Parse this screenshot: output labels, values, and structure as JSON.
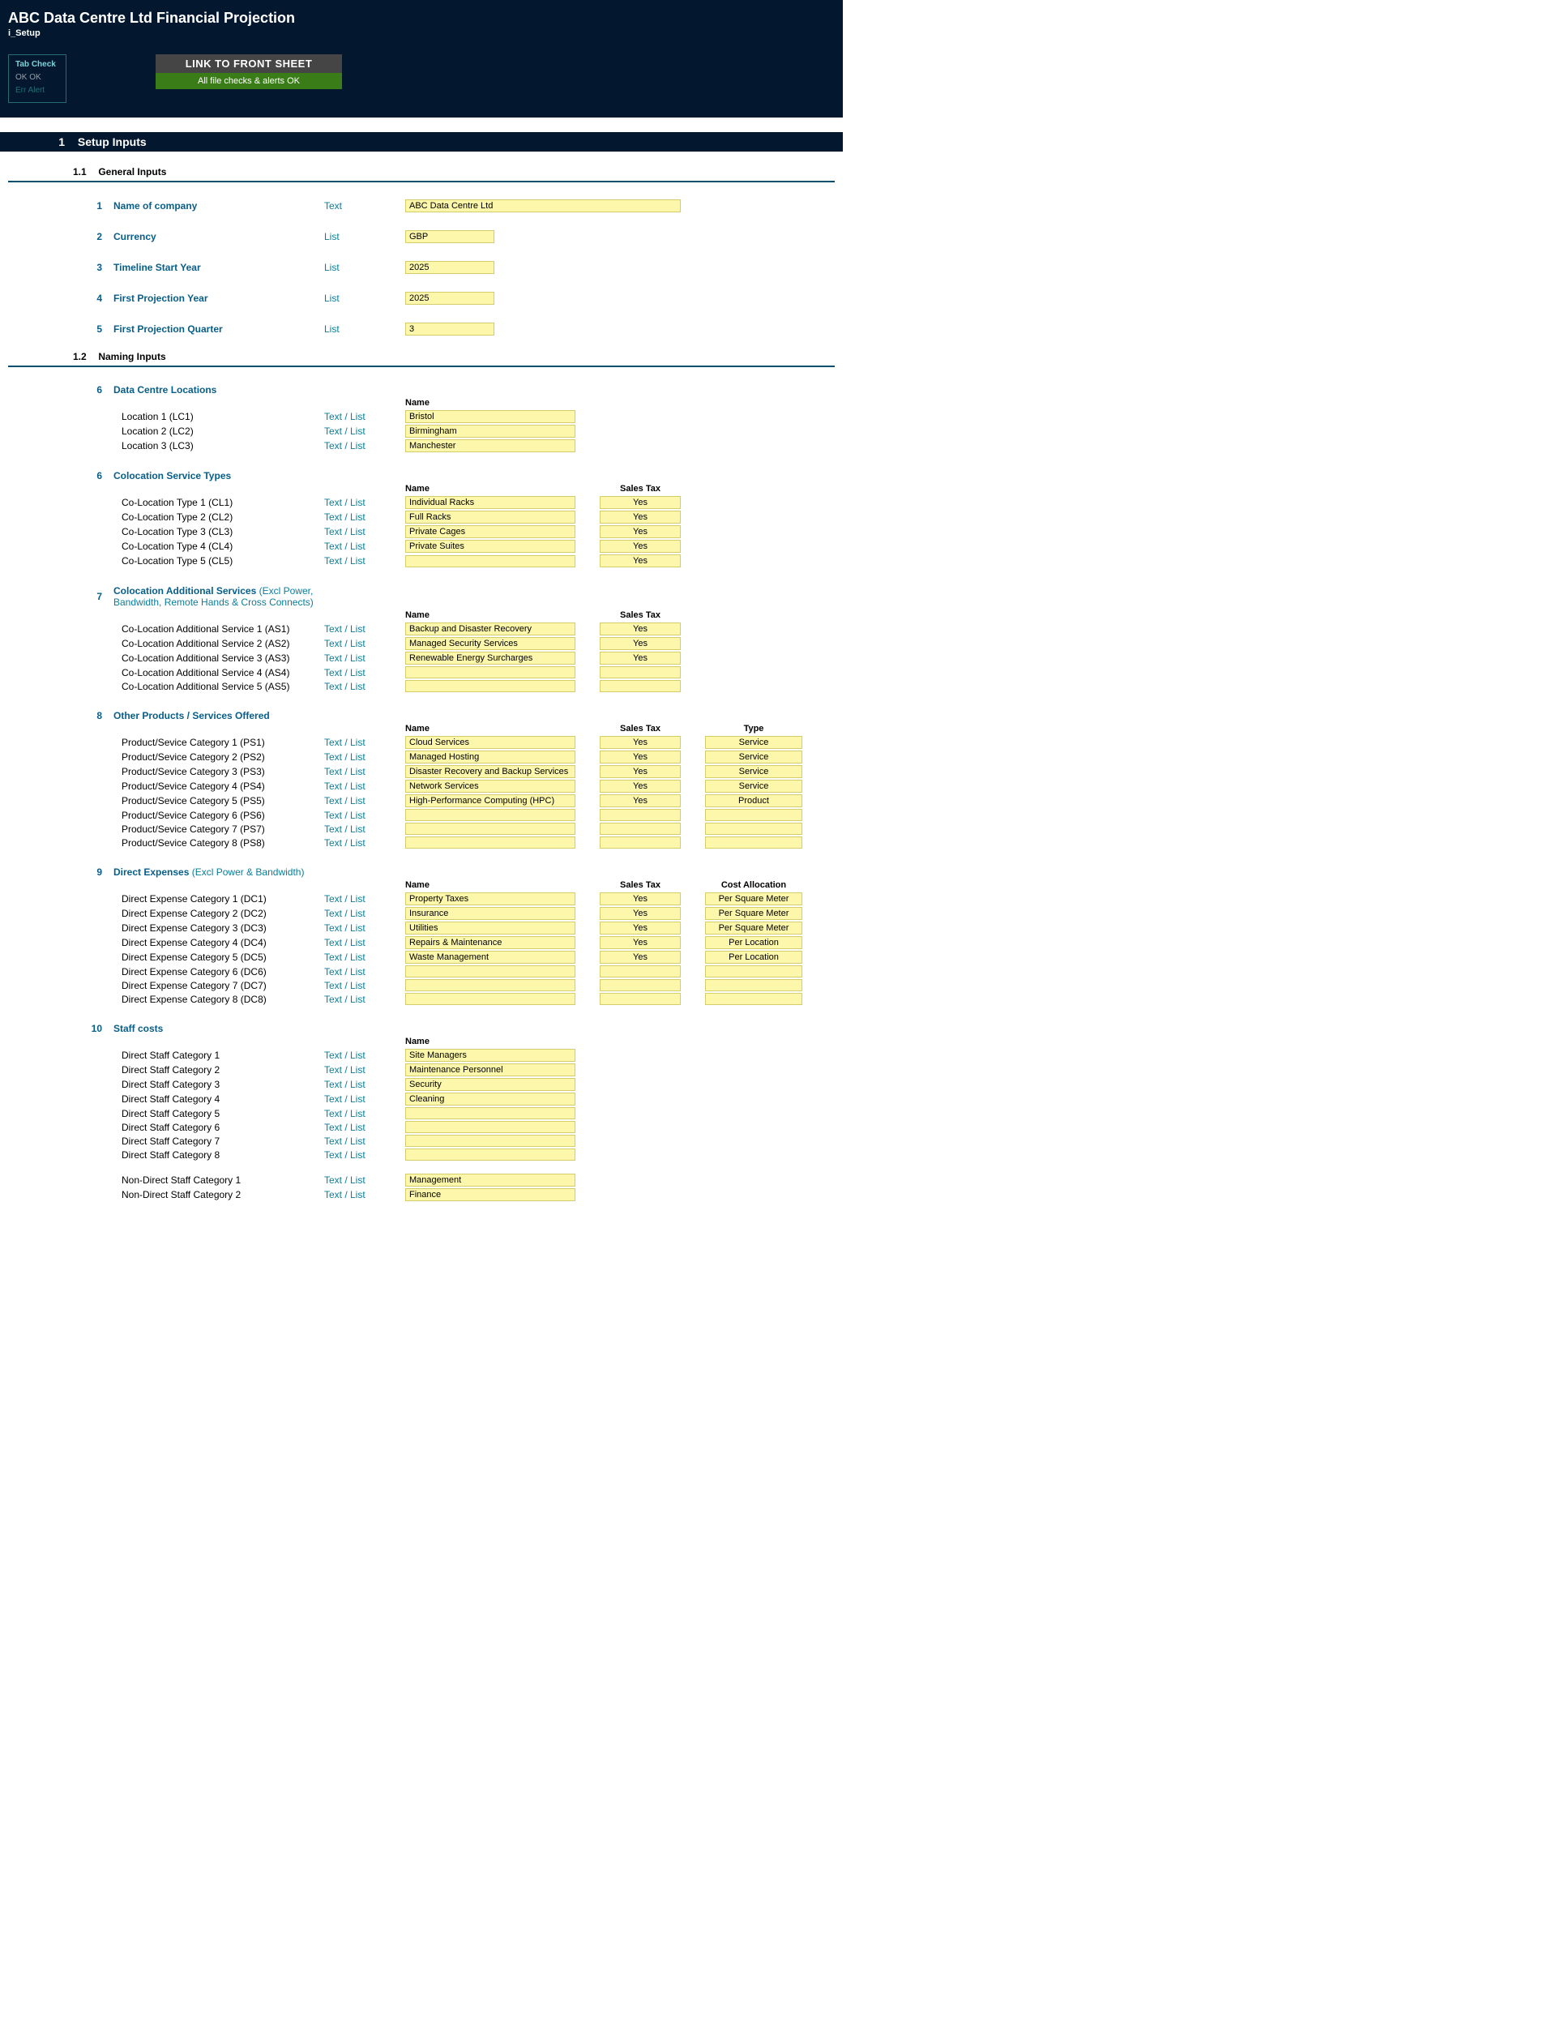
{
  "header": {
    "title": "ABC Data Centre Ltd Financial Projection",
    "subtitle": "i_Setup",
    "tabcheck": {
      "title": "Tab Check",
      "ok_row": "OK   OK",
      "err_row": "Err   Alert"
    },
    "linkbox": {
      "line1": "LINK TO FRONT SHEET",
      "line2": "All file checks & alerts OK"
    }
  },
  "section1": {
    "num": "1",
    "title": "Setup Inputs"
  },
  "sub11": {
    "num": "1.1",
    "title": "General Inputs"
  },
  "general": [
    {
      "idx": "1",
      "label": "Name of company",
      "type": "Text",
      "value": "ABC Data Centre Ltd",
      "wide": true
    },
    {
      "idx": "2",
      "label": "Currency",
      "type": "List",
      "value": "GBP",
      "short": true
    },
    {
      "idx": "3",
      "label": "Timeline Start Year",
      "type": "List",
      "value": "2025",
      "short": true
    },
    {
      "idx": "4",
      "label": "First Projection Year",
      "type": "List",
      "value": "2025",
      "short": true
    },
    {
      "idx": "5",
      "label": "First Projection Quarter",
      "type": "List",
      "value": "3",
      "short": true
    }
  ],
  "sub12": {
    "num": "1.2",
    "title": "Naming Inputs"
  },
  "locations": {
    "idx": "6",
    "title": "Data Centre Locations",
    "col1": "Name",
    "rows": [
      {
        "label": "Location 1 (LC1)",
        "type": "Text / List",
        "name": "Bristol"
      },
      {
        "label": "Location 2 (LC2)",
        "type": "Text / List",
        "name": "Birmingham"
      },
      {
        "label": "Location 3 (LC3)",
        "type": "Text / List",
        "name": "Manchester"
      }
    ]
  },
  "coloc": {
    "idx": "6",
    "title": "Colocation Service Types",
    "col1": "Name",
    "col2": "Sales Tax",
    "rows": [
      {
        "label": "Co-Location Type 1 (CL1)",
        "type": "Text / List",
        "name": "Individual Racks",
        "tax": "Yes"
      },
      {
        "label": "Co-Location Type 2 (CL2)",
        "type": "Text / List",
        "name": "Full Racks",
        "tax": "Yes"
      },
      {
        "label": "Co-Location Type 3 (CL3)",
        "type": "Text / List",
        "name": "Private Cages",
        "tax": "Yes"
      },
      {
        "label": "Co-Location Type 4 (CL4)",
        "type": "Text / List",
        "name": "Private Suites",
        "tax": "Yes"
      },
      {
        "label": "Co-Location Type 5 (CL5)",
        "type": "Text / List",
        "name": "",
        "tax": "Yes"
      }
    ]
  },
  "addsvc": {
    "idx": "7",
    "title": "Colocation Additional Services",
    "note": "(Excl Power, Bandwidth, Remote Hands & Cross Connects)",
    "col1": "Name",
    "col2": "Sales Tax",
    "rows": [
      {
        "label": "Co-Location Additional Service 1 (AS1)",
        "type": "Text / List",
        "name": "Backup and Disaster Recovery",
        "tax": "Yes"
      },
      {
        "label": "Co-Location Additional Service 2 (AS2)",
        "type": "Text / List",
        "name": "Managed Security Services",
        "tax": "Yes"
      },
      {
        "label": "Co-Location Additional Service 3 (AS3)",
        "type": "Text / List",
        "name": "Renewable Energy Surcharges",
        "tax": "Yes"
      },
      {
        "label": "Co-Location Additional Service 4 (AS4)",
        "type": "Text / List",
        "name": "",
        "tax": ""
      },
      {
        "label": "Co-Location Additional Service 5 (AS5)",
        "type": "Text / List",
        "name": "",
        "tax": ""
      }
    ]
  },
  "products": {
    "idx": "8",
    "title": "Other Products / Services Offered",
    "col1": "Name",
    "col2": "Sales Tax",
    "col3": "Type",
    "rows": [
      {
        "label": "Product/Sevice Category 1 (PS1)",
        "type": "Text / List",
        "name": "Cloud Services",
        "tax": "Yes",
        "ptype": "Service"
      },
      {
        "label": "Product/Sevice Category 2 (PS2)",
        "type": "Text / List",
        "name": "Managed Hosting",
        "tax": "Yes",
        "ptype": "Service"
      },
      {
        "label": "Product/Sevice Category 3 (PS3)",
        "type": "Text / List",
        "name": "Disaster Recovery and Backup Services",
        "tax": "Yes",
        "ptype": "Service"
      },
      {
        "label": "Product/Sevice Category 4 (PS4)",
        "type": "Text / List",
        "name": "Network Services",
        "tax": "Yes",
        "ptype": "Service"
      },
      {
        "label": "Product/Sevice Category 5 (PS5)",
        "type": "Text / List",
        "name": "High-Performance Computing (HPC)",
        "tax": "Yes",
        "ptype": "Product"
      },
      {
        "label": "Product/Sevice Category 6 (PS6)",
        "type": "Text / List",
        "name": "",
        "tax": "",
        "ptype": ""
      },
      {
        "label": "Product/Sevice Category 7 (PS7)",
        "type": "Text / List",
        "name": "",
        "tax": "",
        "ptype": ""
      },
      {
        "label": "Product/Sevice Category 8 (PS8)",
        "type": "Text / List",
        "name": "",
        "tax": "",
        "ptype": ""
      }
    ]
  },
  "expenses": {
    "idx": "9",
    "title": "Direct Expenses",
    "note": "(Excl Power & Bandwidth)",
    "col1": "Name",
    "col2": "Sales Tax",
    "col3": "Cost Allocation",
    "rows": [
      {
        "label": "Direct Expense Category 1 (DC1)",
        "type": "Text / List",
        "name": "Property Taxes",
        "tax": "Yes",
        "alloc": "Per Square Meter"
      },
      {
        "label": "Direct Expense Category 2 (DC2)",
        "type": "Text / List",
        "name": "Insurance",
        "tax": "Yes",
        "alloc": "Per Square Meter"
      },
      {
        "label": "Direct Expense Category 3 (DC3)",
        "type": "Text / List",
        "name": "Utilities",
        "tax": "Yes",
        "alloc": "Per Square Meter"
      },
      {
        "label": "Direct Expense Category 4 (DC4)",
        "type": "Text / List",
        "name": "Repairs & Maintenance",
        "tax": "Yes",
        "alloc": "Per Location"
      },
      {
        "label": "Direct Expense Category 5 (DC5)",
        "type": "Text / List",
        "name": "Waste Management",
        "tax": "Yes",
        "alloc": "Per Location"
      },
      {
        "label": "Direct Expense Category 6 (DC6)",
        "type": "Text / List",
        "name": "",
        "tax": "",
        "alloc": ""
      },
      {
        "label": "Direct Expense Category 7 (DC7)",
        "type": "Text / List",
        "name": "",
        "tax": "",
        "alloc": ""
      },
      {
        "label": "Direct Expense Category 8 (DC8)",
        "type": "Text / List",
        "name": "",
        "tax": "",
        "alloc": ""
      }
    ]
  },
  "staff": {
    "idx": "10",
    "title": "Staff costs",
    "col1": "Name",
    "direct": [
      {
        "label": "Direct Staff Category 1",
        "type": "Text / List",
        "name": "Site Managers"
      },
      {
        "label": "Direct Staff Category 2",
        "type": "Text / List",
        "name": "Maintenance Personnel"
      },
      {
        "label": "Direct Staff Category 3",
        "type": "Text / List",
        "name": "Security"
      },
      {
        "label": "Direct Staff Category 4",
        "type": "Text / List",
        "name": "Cleaning"
      },
      {
        "label": "Direct Staff Category 5",
        "type": "Text / List",
        "name": ""
      },
      {
        "label": "Direct Staff Category 6",
        "type": "Text / List",
        "name": ""
      },
      {
        "label": "Direct Staff Category 7",
        "type": "Text / List",
        "name": ""
      },
      {
        "label": "Direct Staff Category 8",
        "type": "Text / List",
        "name": ""
      }
    ],
    "nondirect": [
      {
        "label": "Non-Direct Staff Category 1",
        "type": "Text / List",
        "name": "Management"
      },
      {
        "label": "Non-Direct Staff Category 2",
        "type": "Text / List",
        "name": "Finance"
      }
    ]
  }
}
